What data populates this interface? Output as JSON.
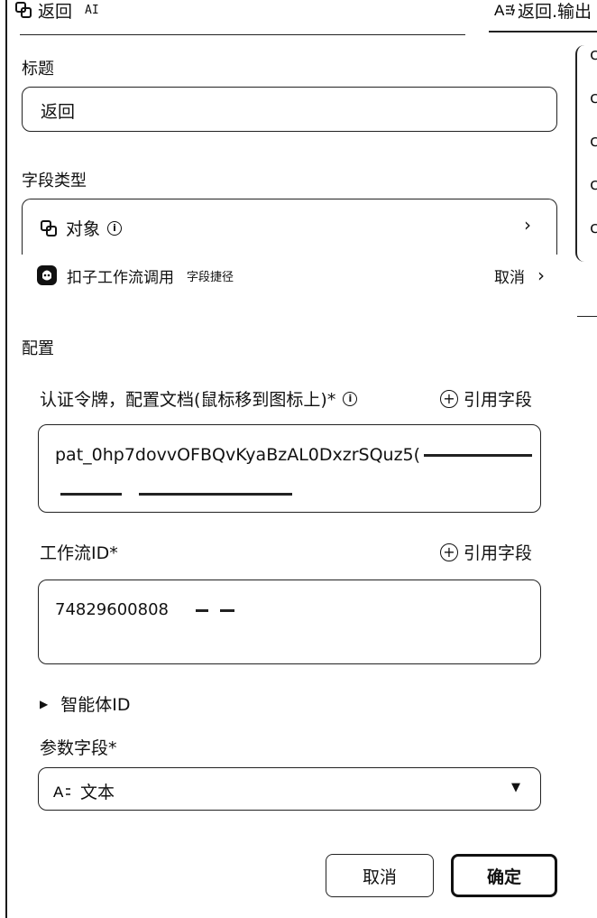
{
  "header": {
    "title": "返回",
    "ai_tag": "AI",
    "right_tab": "返回.输出"
  },
  "side_items": [
    "c",
    "c",
    "c",
    "c",
    "c"
  ],
  "title_section": {
    "label": "标题",
    "value": "返回"
  },
  "field_type": {
    "label": "字段类型",
    "value": "对象"
  },
  "shortcut": {
    "name": "扣子工作流调用",
    "tag": "字段捷径",
    "cancel": "取消"
  },
  "config": {
    "label": "配置",
    "token_label": "认证令牌，配置文档(鼠标移到图标上)*",
    "token_ref": "引用字段",
    "token_value": "pat_0hp7dovvOFBQvKyaBzAL0DxzrSQuz5(",
    "workflow_label": "工作流ID*",
    "workflow_ref": "引用字段",
    "workflow_value": "74829600808",
    "agent_label": "智能体ID",
    "params_label": "参数字段*",
    "params_value": "文本"
  },
  "footer": {
    "cancel": "取消",
    "confirm": "确定"
  }
}
